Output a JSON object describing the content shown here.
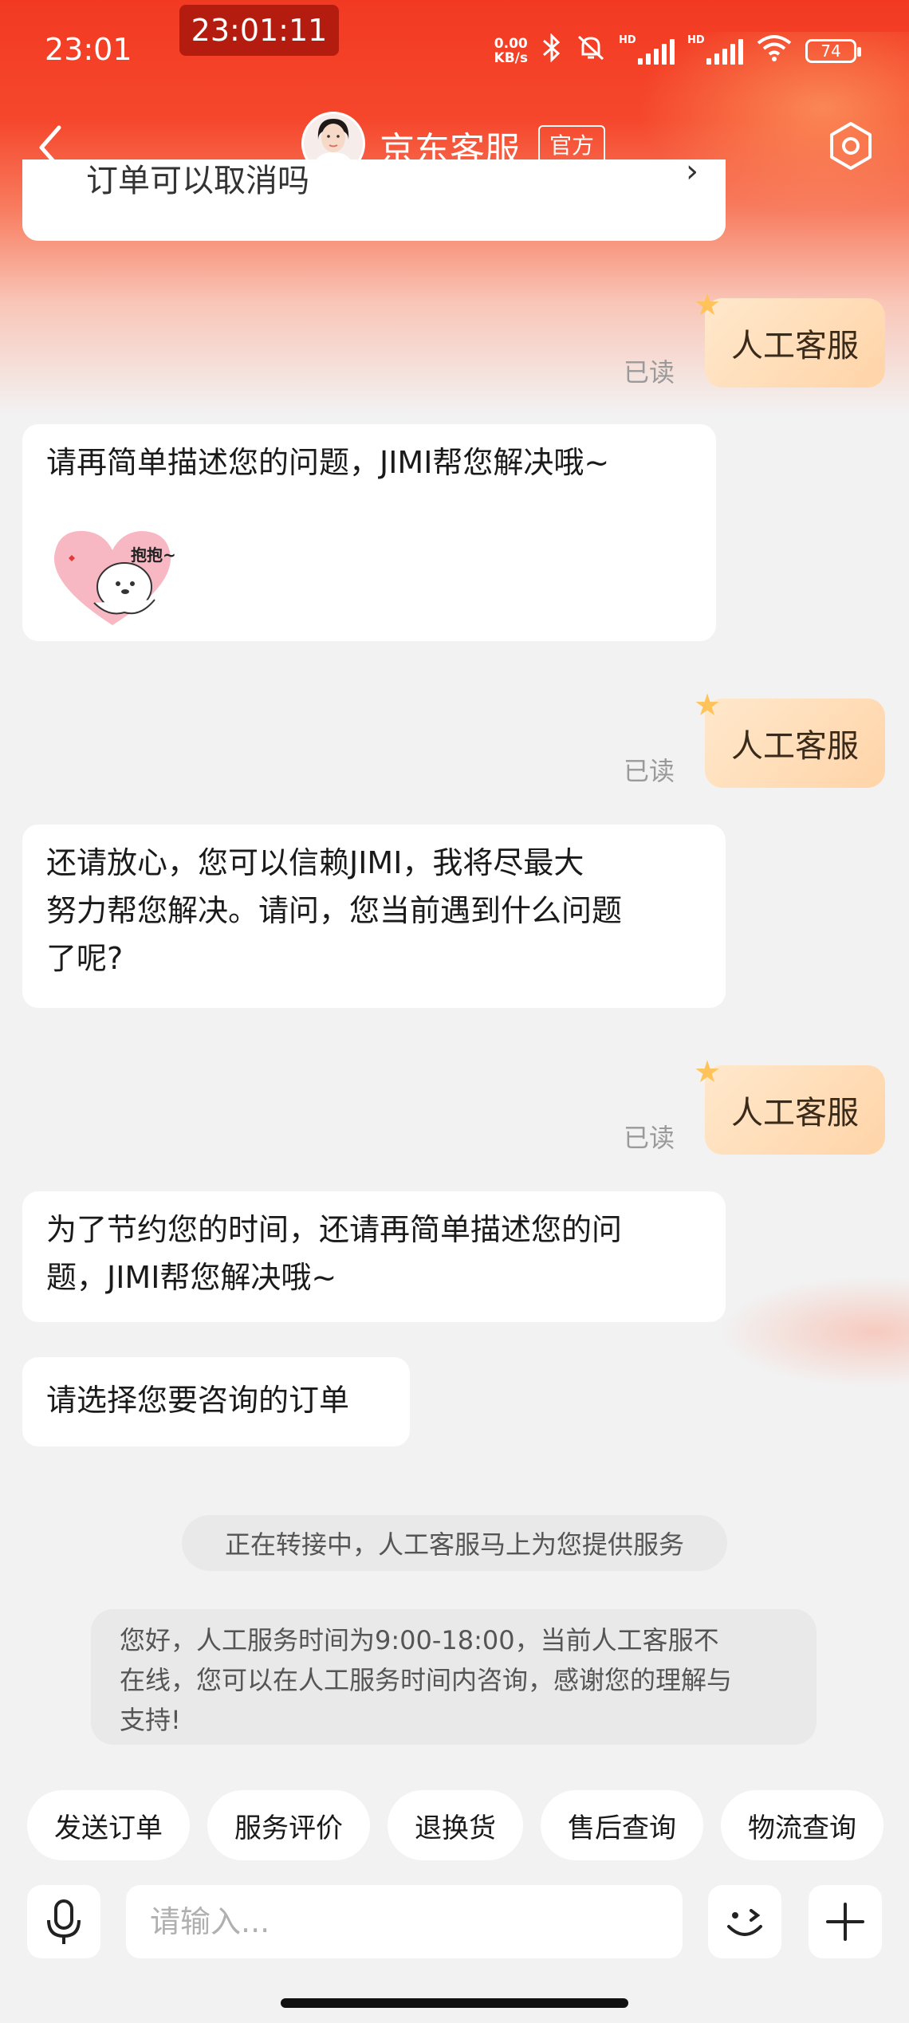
{
  "status_bar": {
    "time": "23:01",
    "record_time": "23:01:11",
    "net_speed_value": "0.00",
    "net_speed_unit": "KB/s",
    "battery": "74",
    "hd_label": "HD"
  },
  "header": {
    "title": "京东客服",
    "official_badge": "官方"
  },
  "chat": {
    "cut_message": "订单可以取消吗",
    "cut_chevron": "›",
    "read_label": "已读",
    "user_messages": [
      "人工客服",
      "人工客服",
      "人工客服"
    ],
    "bot_messages": [
      "请再简单描述您的问题，JIMI帮您解决哦~",
      "还请放心，您可以信赖JIMI，我将尽最大",
      "努力帮您解决。请问，您当前遇到什么问题",
      "了呢?",
      "为了节约您的时间，还请再简单描述您的问",
      "题，JIMI帮您解决哦~",
      "请选择您要咨询的订单"
    ],
    "sticker_text": "抱抱~",
    "system_transfer": "正在转接中，人工客服马上为您提供服务",
    "system_note_lines": [
      "您好，人工服务时间为9:00-18:00，当前人工客服不",
      "在线，您可以在人工服务时间内咨询，感谢您的理解与",
      "支持!"
    ]
  },
  "quick_replies": [
    "发送订单",
    "服务评价",
    "退换货",
    "售后查询",
    "物流查询"
  ],
  "input": {
    "placeholder": "请输入..."
  },
  "colors": {
    "brand_red": "#f23a22",
    "user_bubble": "#ffdcb8",
    "background": "#f2f2f2"
  }
}
